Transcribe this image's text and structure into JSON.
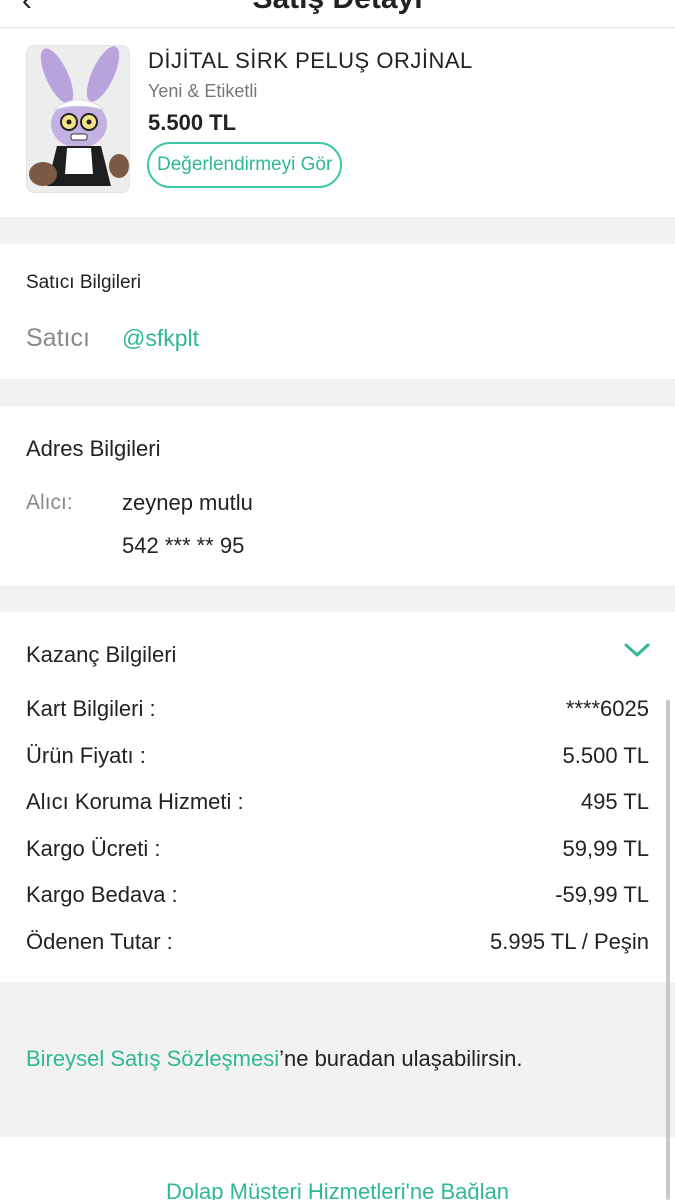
{
  "header": {
    "back_glyph": "‹",
    "title": "Satış Detayı",
    "back_icon": "chevron-left-icon"
  },
  "product": {
    "name": "DİJİTAL SİRK PELUŞ ORJİNAL",
    "condition": "Yeni & Etiketli",
    "price": "5.500 TL",
    "review_button": "Değerlendirmeyi Gör"
  },
  "seller": {
    "section_title": "Satıcı Bilgileri",
    "label": "Satıcı",
    "username": "@sfkplt"
  },
  "address": {
    "section_title": "Adres Bilgileri",
    "label": "Alıcı:",
    "name": "zeynep mutlu",
    "phone": "542 *** ** 95"
  },
  "earnings": {
    "section_title": "Kazanç Bilgileri",
    "toggle_icon": "chevron-down-icon",
    "rows": [
      {
        "label": "Kart Bilgileri :",
        "value": "****6025"
      },
      {
        "label": "Ürün Fiyatı :",
        "value": "5.500 TL"
      },
      {
        "label": "Alıcı Koruma Hizmeti :",
        "value": "495 TL"
      },
      {
        "label": "Kargo Ücreti :",
        "value": "59,99 TL"
      },
      {
        "label": "Kargo Bedava :",
        "value": "-59,99 TL"
      },
      {
        "label": "Ödenen Tutar :",
        "value": "5.995 TL / Peşin"
      }
    ]
  },
  "footer": {
    "contract_link": "Bireysel Satış Sözleşmesi",
    "contract_text": "’ne buradan ulaşabilirsin.",
    "support_link": "Dolap Müşteri Hizmetleri'ne Bağlan"
  },
  "colors": {
    "accent": "#2fb896",
    "background": "#f2f2f2",
    "card": "#ffffff"
  }
}
